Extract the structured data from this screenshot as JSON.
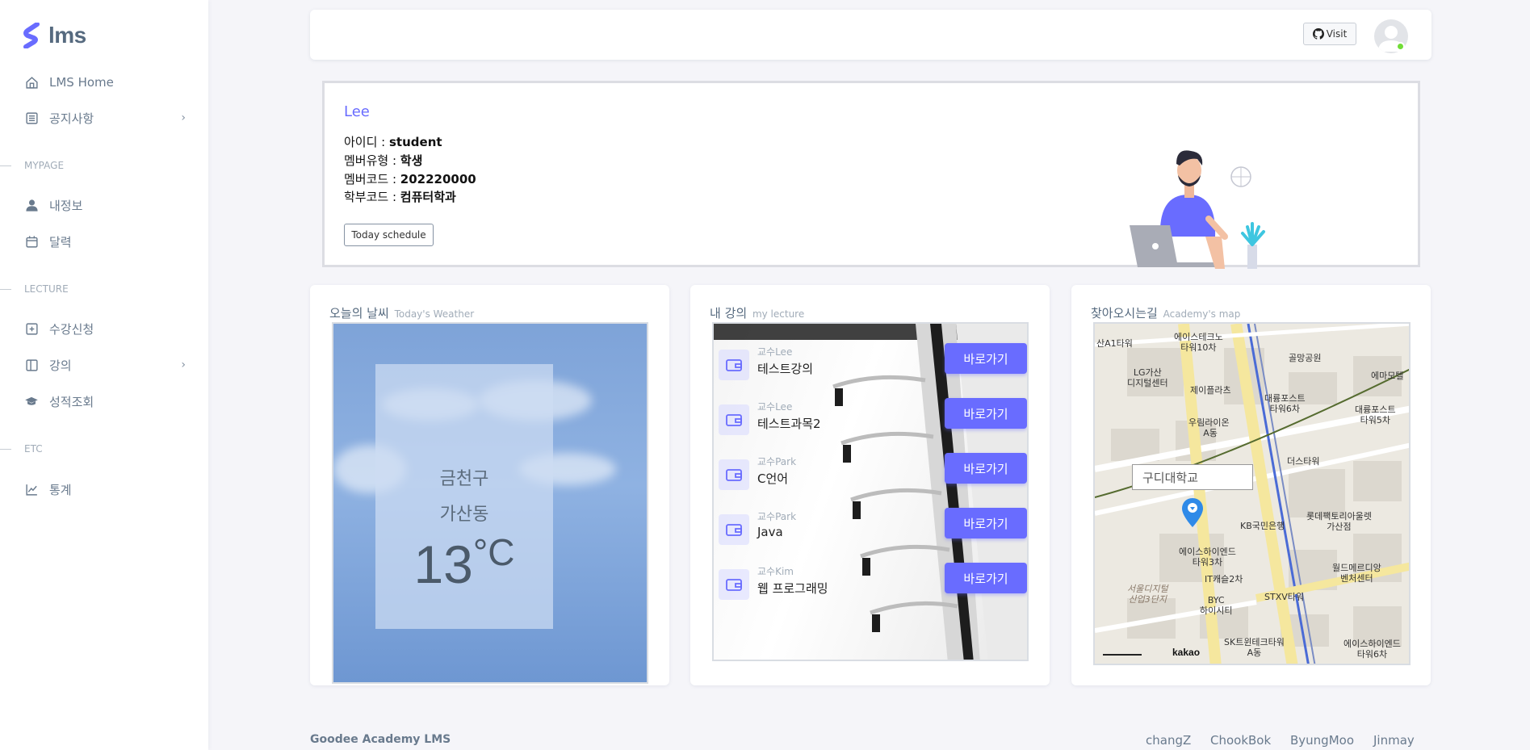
{
  "sidebar": {
    "brand": "lms",
    "items": [
      {
        "label": "LMS Home"
      },
      {
        "label": "공지사항"
      },
      {
        "label": "내정보"
      },
      {
        "label": "달력"
      },
      {
        "label": "수강신청"
      },
      {
        "label": "강의"
      },
      {
        "label": "성적조회"
      },
      {
        "label": "통계"
      }
    ],
    "headers": [
      "MYPAGE",
      "LECTURE",
      "ETC"
    ]
  },
  "navbar": {
    "visit_label": "Visit"
  },
  "profile": {
    "name": "Lee",
    "fields": [
      {
        "label": "아이디 : ",
        "value": "student"
      },
      {
        "label": "멤버유형 : ",
        "value": "학생"
      },
      {
        "label": "멤버코드 : ",
        "value": "202220000"
      },
      {
        "label": "학부코드 : ",
        "value": "컴퓨터학과"
      }
    ],
    "today_button": "Today schedule"
  },
  "weather": {
    "title": "오늘의 날씨",
    "subtitle": "Today's Weather",
    "city": "금천구",
    "dong": "가산동",
    "temp": "13",
    "unit": "°C"
  },
  "lecture": {
    "title": "내 강의",
    "subtitle": "my lecture",
    "go_label": "바로가기",
    "items": [
      {
        "prof": "교수Lee",
        "name": "테스트강의"
      },
      {
        "prof": "교수Lee",
        "name": "테스트과목2"
      },
      {
        "prof": "교수Park",
        "name": "C언어"
      },
      {
        "prof": "교수Park",
        "name": "Java"
      },
      {
        "prof": "교수Kim",
        "name": "웹 프로그래밍"
      }
    ]
  },
  "map": {
    "title": "찾아오시는길",
    "subtitle": "Academy's map",
    "search_text": "구디대학교",
    "provider": "kakao",
    "labels": [
      "산A1타워",
      "에이스테크노\n타워10차",
      "골망공원",
      "에마모텔",
      "LG가산\n디지털센터",
      "제이플라츠",
      "대륭포스트\n타워6차",
      "대륭포스트\n타워5차",
      "우림라이온\n A동",
      "더스타워",
      "KB국민은행",
      "롯데팩토리아울렛\n가산점",
      "에이스하이엔드\n타워3차",
      "IT캐슬2차",
      "월드메르디앙\n벤처센터",
      "BYC\n하이시티",
      "STXV타워",
      "SK트윈테크타워\nA동",
      "에이스하이엔드\n타워6차",
      "서울디지털\n산업3단지"
    ]
  },
  "footer": {
    "brand": "Goodee Academy LMS",
    "links": [
      "changZ",
      "ChookBok",
      "ByungMoo",
      "Jinmay"
    ]
  }
}
